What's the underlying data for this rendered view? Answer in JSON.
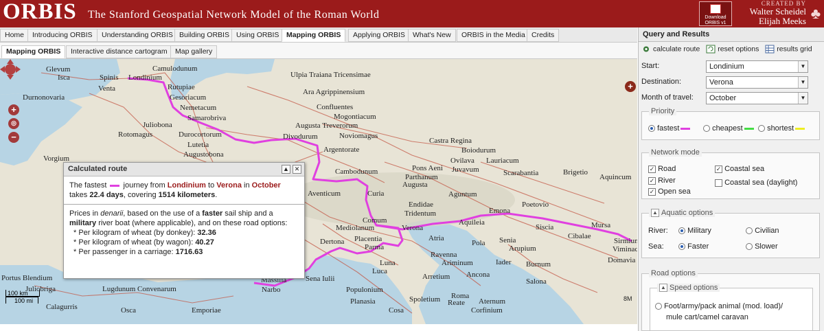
{
  "header": {
    "logo": "ORBIS",
    "tagline": "The Stanford Geospatial Network Model of the Roman World",
    "download_label_1": "Download",
    "download_label_2": "ORBIS v1",
    "created_by": "CREATED BY",
    "author1": "Walter Scheidel",
    "author2": "Elijah Meeks",
    "brand_color": "#9b1b1b"
  },
  "topnav": [
    "Home",
    "Introducing ORBIS",
    "Understanding ORBIS",
    "Building ORBIS",
    "Using ORBIS",
    "Mapping ORBIS",
    "Applying ORBIS",
    "What's New",
    "ORBIS in the Media",
    "Credits"
  ],
  "topnav_active": "Mapping ORBIS",
  "subnav": [
    "Mapping ORBIS",
    "Interactive distance cartogram",
    "Map gallery"
  ],
  "subnav_active": "Mapping ORBIS",
  "map": {
    "labels": [
      "Glevum",
      "Isca",
      "Spinis",
      "Londinium",
      "Camulodunum",
      "Durnonovaria",
      "Venta",
      "Rutupiae",
      "Gesoriacum",
      "Nemetacum",
      "Samarobriva",
      "Juliobona",
      "Rotomagus",
      "Durocortorum",
      "Lutetia",
      "Augustobona",
      "Vorgium",
      "Ulpia Traiana Tricensimae",
      "Ara Agrippinensium",
      "Confluentes",
      "Mogontiacum",
      "Augusta Treverorum",
      "Divodurum",
      "Noviomagus",
      "Argentorate",
      "Castra Regina",
      "Boiodurum",
      "Ovilava",
      "Lauriacum",
      "Juvavum",
      "Pons Aeni",
      "Parthanum",
      "Cambodunum",
      "Scarabantia",
      "Brigetio",
      "Aquincum",
      "Augusta",
      "Aventicum",
      "Curia",
      "Endidae",
      "Tridentum",
      "Aguntum",
      "Poetovio",
      "Emona",
      "Siscia",
      "Cibalae",
      "Mursa",
      "Sirmium",
      "Viminacium",
      "Domavia",
      "Comum",
      "Mediolanum",
      "Verona",
      "Aquileia",
      "Dertona",
      "Placentia",
      "Parma",
      "Atria",
      "Pola",
      "Senia",
      "Arupium",
      "Ravenna",
      "Ariminum",
      "Iader",
      "Burnum",
      "Luna",
      "Luca",
      "Arretium",
      "Ancona",
      "Salona",
      "Populonium",
      "Roma",
      "Sena Iulii",
      "Massilia",
      "Portus Blendium",
      "Juliobriga",
      "Calagurris",
      "Lugdunum Convenarum",
      "Osca",
      "Emporiae",
      "Planasia",
      "Spoletium",
      "Reate",
      "Aternum",
      "Corfinium",
      "Narbo",
      "Cosa"
    ],
    "scale_km": "100 km",
    "scale_mi": "100 mi",
    "attribution": "8M"
  },
  "popup": {
    "title": "Calculated route",
    "p1_a": "The fastest",
    "p1_b": "journey from",
    "origin": "Londinium",
    "p1_c": "to",
    "destination": "Verona",
    "p1_d": "in",
    "month": "October",
    "p2_a": "takes",
    "days": "22.4 days",
    "p2_b": ", covering",
    "km": "1514 kilometers",
    "p2_c": ".",
    "p3": "Prices in",
    "denarii": "denarii",
    "p3b": ", based on the use of a",
    "faster": "faster",
    "p3c": "sail ship and a",
    "military": "military",
    "p3d": "river boat (where applicable), and on these road options:",
    "prices": [
      {
        "label": "* Per kilogram of wheat (by donkey):",
        "value": "32.36"
      },
      {
        "label": "* Per kilogram of wheat (by wagon):",
        "value": "40.27"
      },
      {
        "label": "* Per passenger in a carriage:",
        "value": "1716.63"
      }
    ]
  },
  "panel": {
    "title": "Query and Results",
    "calc": "calculate route",
    "reset": "reset options",
    "grid": "results grid",
    "start_label": "Start:",
    "start_value": "Londinium",
    "dest_label": "Destination:",
    "dest_value": "Verona",
    "month_label": "Month of travel:",
    "month_value": "October",
    "priority_legend": "Priority",
    "priority": [
      {
        "label": "fastest",
        "color": "#e040e0",
        "checked": true
      },
      {
        "label": "cheapest",
        "color": "#44dd44",
        "checked": false
      },
      {
        "label": "shortest",
        "color": "#eeee22",
        "checked": false
      }
    ],
    "network_legend": "Network mode",
    "network": [
      {
        "label": "Road",
        "checked": true
      },
      {
        "label": "River",
        "checked": true
      },
      {
        "label": "Open sea",
        "checked": true
      },
      {
        "label": "Coastal sea",
        "checked": true
      },
      {
        "label": "Coastal sea (daylight)",
        "checked": false
      }
    ],
    "aquatic_legend": "Aquatic options",
    "river_label": "River:",
    "river_opts": [
      "Military",
      "Civilian"
    ],
    "sea_label": "Sea:",
    "sea_opts": [
      "Faster",
      "Slower"
    ],
    "road_legend": "Road options",
    "speed_legend": "Speed options",
    "speed_opt_1": "Foot/army/pack animal (mod. load)/",
    "speed_opt_2": "mule cart/camel caravan"
  }
}
